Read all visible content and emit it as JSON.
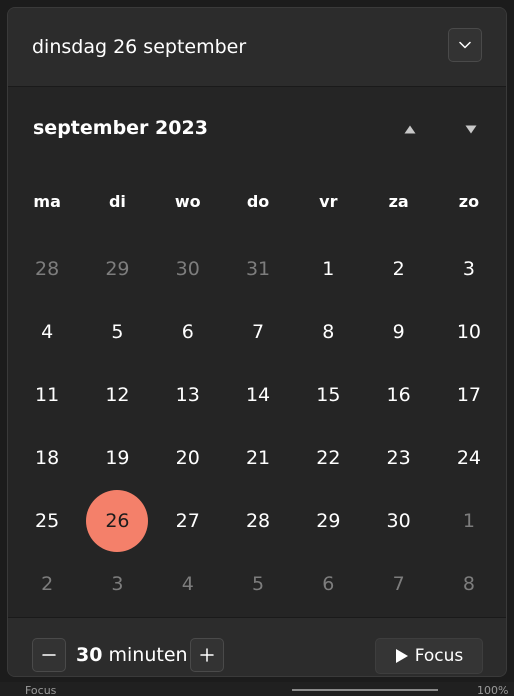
{
  "header": {
    "title": "dinsdag 26 september"
  },
  "calendar": {
    "month_label": "september 2023",
    "weekdays": [
      "ma",
      "di",
      "wo",
      "do",
      "vr",
      "za",
      "zo"
    ],
    "days": [
      {
        "label": "28",
        "current_month": false
      },
      {
        "label": "29",
        "current_month": false
      },
      {
        "label": "30",
        "current_month": false
      },
      {
        "label": "31",
        "current_month": false
      },
      {
        "label": "1",
        "current_month": true
      },
      {
        "label": "2",
        "current_month": true
      },
      {
        "label": "3",
        "current_month": true
      },
      {
        "label": "4",
        "current_month": true
      },
      {
        "label": "5",
        "current_month": true
      },
      {
        "label": "6",
        "current_month": true
      },
      {
        "label": "7",
        "current_month": true
      },
      {
        "label": "8",
        "current_month": true
      },
      {
        "label": "9",
        "current_month": true
      },
      {
        "label": "10",
        "current_month": true
      },
      {
        "label": "11",
        "current_month": true
      },
      {
        "label": "12",
        "current_month": true
      },
      {
        "label": "13",
        "current_month": true
      },
      {
        "label": "14",
        "current_month": true
      },
      {
        "label": "15",
        "current_month": true
      },
      {
        "label": "16",
        "current_month": true
      },
      {
        "label": "17",
        "current_month": true
      },
      {
        "label": "18",
        "current_month": true
      },
      {
        "label": "19",
        "current_month": true
      },
      {
        "label": "20",
        "current_month": true
      },
      {
        "label": "21",
        "current_month": true
      },
      {
        "label": "22",
        "current_month": true
      },
      {
        "label": "23",
        "current_month": true
      },
      {
        "label": "24",
        "current_month": true
      },
      {
        "label": "25",
        "current_month": true
      },
      {
        "label": "26",
        "current_month": true,
        "selected": true
      },
      {
        "label": "27",
        "current_month": true
      },
      {
        "label": "28",
        "current_month": true
      },
      {
        "label": "29",
        "current_month": true
      },
      {
        "label": "30",
        "current_month": true
      },
      {
        "label": "1",
        "current_month": false
      },
      {
        "label": "2",
        "current_month": false
      },
      {
        "label": "3",
        "current_month": false
      },
      {
        "label": "4",
        "current_month": false
      },
      {
        "label": "5",
        "current_month": false
      },
      {
        "label": "6",
        "current_month": false
      },
      {
        "label": "7",
        "current_month": false
      },
      {
        "label": "8",
        "current_month": false
      }
    ],
    "selected_color": "#f4806a"
  },
  "footer": {
    "duration_value": "30",
    "duration_unit": "minuten",
    "focus_label": "Focus",
    "minus_icon": "minus-icon",
    "plus_icon": "plus-icon",
    "focus_icon": "play-icon"
  },
  "taskbar": {
    "focus_text": "Focus",
    "zoom_text": "100%"
  }
}
